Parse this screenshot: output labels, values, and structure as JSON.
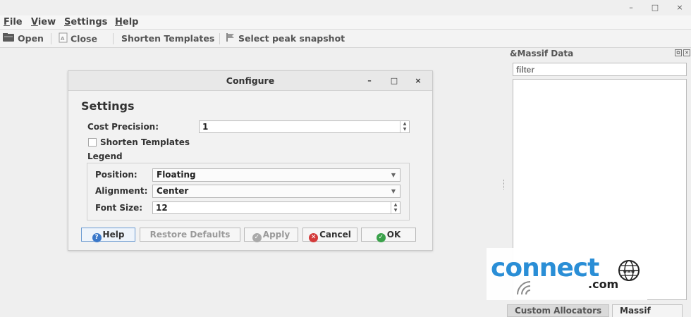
{
  "window": {
    "controls": {
      "minimize": "–",
      "maximize": "□",
      "close": "×"
    }
  },
  "menubar": {
    "items": [
      {
        "pre": "",
        "key": "F",
        "post": "ile"
      },
      {
        "pre": "",
        "key": "V",
        "post": "iew"
      },
      {
        "pre": "",
        "key": "S",
        "post": "ettings"
      },
      {
        "pre": "",
        "key": "H",
        "post": "elp"
      }
    ]
  },
  "toolbar": {
    "open_label": "Open",
    "close_label": "Close",
    "shorten_label": "Shorten Templates",
    "peak_label": "Select peak snapshot"
  },
  "dock": {
    "title": "&Massif Data",
    "filter_placeholder": "filter",
    "tabs": [
      "Custom Allocators",
      "Massif Data"
    ],
    "active_tab": "Massif Data"
  },
  "dialog": {
    "title": "Configure",
    "controls": {
      "minimize": "–",
      "maximize": "□",
      "close": "×"
    },
    "heading": "Settings",
    "cost_precision_label": "Cost Precision:",
    "cost_precision_value": "1",
    "shorten_templates_label": "Shorten Templates",
    "shorten_templates_checked": false,
    "legend_label": "Legend",
    "position_label": "Position:",
    "position_value": "Floating",
    "alignment_label": "Alignment:",
    "alignment_value": "Center",
    "font_size_label": "Font Size:",
    "font_size_value": "12",
    "buttons": {
      "help": "Help",
      "restore": "Restore Defaults",
      "apply": "Apply",
      "cancel": "Cancel",
      "ok": "OK"
    }
  },
  "watermark": {
    "brand": "connect",
    "suffix": ".com",
    "globe_text": "www",
    "brand_color": "#2a8ed6"
  }
}
